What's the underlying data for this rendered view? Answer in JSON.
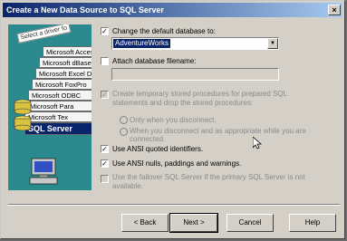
{
  "window": {
    "title": "Create a New Data Source to SQL Server",
    "close_glyph": "×"
  },
  "illustration": {
    "note_text": "Select a driver fo",
    "drivers": [
      "Microsoft Access Dr",
      "Microsoft dBase Dr",
      "Microsoft Excel Dr",
      "Microsoft FoxPro",
      "Microsoft ODBC",
      "Microsoft Para",
      "Microsoft Tex",
      "SQL Server"
    ],
    "selected_index": 7
  },
  "options": {
    "change_default_db": {
      "label": "Change the default database to:",
      "checked": true
    },
    "database_combo": {
      "value": "AdventureWorks"
    },
    "attach_filename": {
      "label": "Attach database filename:",
      "checked": false
    },
    "create_temp_sp": {
      "label": "Create temporary stored procedures for prepared SQL statements and drop the stored procedures:",
      "checked": true,
      "enabled": false
    },
    "radio_disconnect": {
      "label": "Only when you disconnect."
    },
    "radio_disconnect_appropriate": {
      "label": "When you disconnect and as appropriate while you are connected."
    },
    "quoted_identifiers": {
      "label": "Use ANSI quoted identifiers.",
      "checked": true
    },
    "ansi_nulls": {
      "label": "Use ANSI nulls, paddings and warnings.",
      "checked": true
    },
    "failover": {
      "label": "Use the failover SQL Server if the primary SQL Server is not available.",
      "checked": false,
      "enabled": false
    }
  },
  "buttons": {
    "back": "< Back",
    "next": "Next >",
    "cancel": "Cancel",
    "help": "Help"
  },
  "colors": {
    "dialog_bg": "#d4d0c8",
    "title_start": "#0a246a",
    "title_end": "#a6caf0",
    "illustration_bg": "#2a8a8e"
  }
}
